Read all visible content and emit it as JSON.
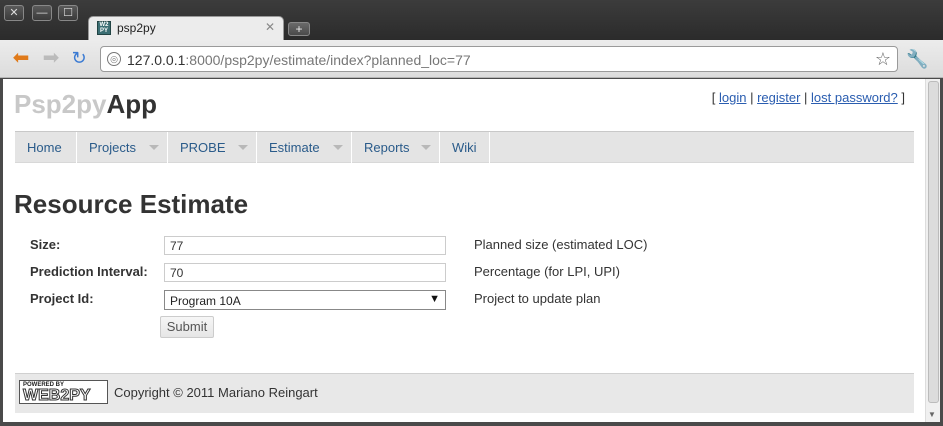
{
  "window": {
    "buttons": {
      "close": "✕",
      "minimize": "—",
      "maximize": "☐"
    },
    "tab": {
      "title": "psp2py",
      "favicon": "web2py-icon",
      "close": "✕"
    },
    "new_tab": "+"
  },
  "toolbar": {
    "url_host": "127.0.0.1",
    "url_rest": ":8000/psp2py/estimate/index?planned_loc=77"
  },
  "header": {
    "brand_light": "Psp2py",
    "brand_dark": "App",
    "auth": {
      "open": "[ ",
      "login": "login",
      "sep1": " | ",
      "register": "register",
      "sep2": " | ",
      "lost_password": "lost password?",
      "close": " ]"
    }
  },
  "menu": {
    "items": [
      {
        "label": "Home",
        "has_caret": false
      },
      {
        "label": "Projects",
        "has_caret": true
      },
      {
        "label": "PROBE",
        "has_caret": true
      },
      {
        "label": "Estimate",
        "has_caret": true
      },
      {
        "label": "Reports",
        "has_caret": true
      },
      {
        "label": "Wiki",
        "has_caret": false
      }
    ]
  },
  "main": {
    "title": "Resource Estimate",
    "form": {
      "size": {
        "label": "Size:",
        "value": "77",
        "help": "Planned size (estimated LOC)"
      },
      "interval": {
        "label": "Prediction Interval:",
        "value": "70",
        "help": "Percentage (for LPI, UPI)"
      },
      "project": {
        "label": "Project Id:",
        "value": "Program 10A",
        "help": "Project to update plan"
      },
      "submit": "Submit"
    }
  },
  "footer": {
    "logo_top": "POWERED BY",
    "logo_main": "WEB2PY",
    "copyright": "Copyright © 2011 Mariano Reingart"
  }
}
